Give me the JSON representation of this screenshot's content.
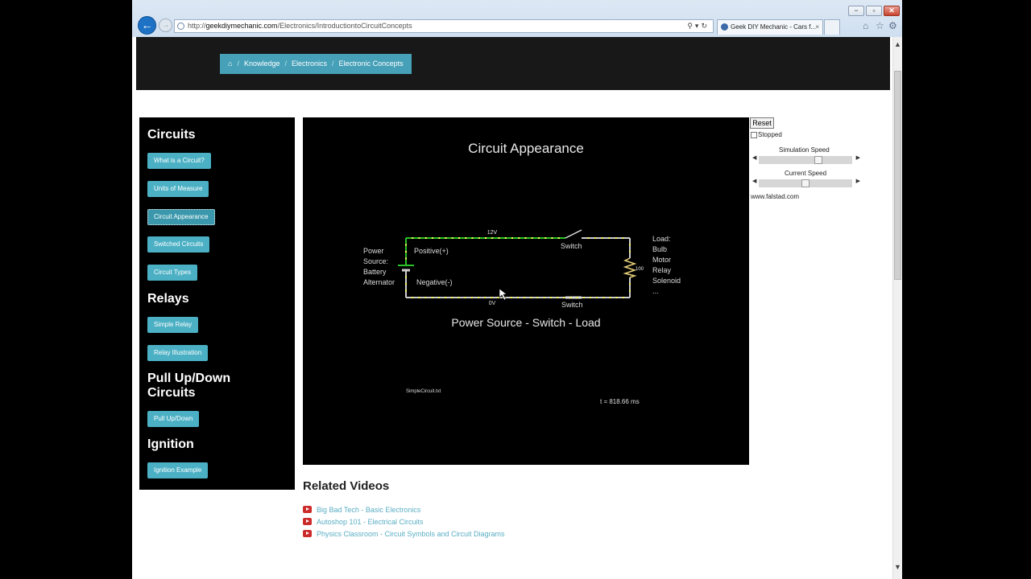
{
  "browser": {
    "url_prefix": "http://",
    "url_domain": "geekdiymechanic.com",
    "url_path": "/Electronics/IntroductiontoCircuitConcepts",
    "tab_title": "Geek DIY Mechanic - Cars f...",
    "tab_close": "×",
    "window_controls": [
      "−",
      "▫",
      "✕"
    ]
  },
  "breadcrumb": {
    "home_icon": "home-icon",
    "items": [
      "Knowledge",
      "Electronics",
      "Electronic Concepts"
    ]
  },
  "sidebar": {
    "circuits": {
      "heading": "Circuits",
      "items": [
        "What is a Circuit?",
        "Units of Measure",
        "Circuit Appearance",
        "Switched Circuits",
        "Circuit Types"
      ]
    },
    "relays": {
      "heading": "Relays",
      "items": [
        "Simple Relay",
        "Relay Illustration"
      ]
    },
    "pullupdown": {
      "heading_line1": "Pull Up/Down",
      "heading_line2": "Circuits",
      "items": [
        "Pull Up/Down"
      ]
    },
    "ignition": {
      "heading": "Ignition",
      "items": [
        "Ignition Example"
      ]
    }
  },
  "simulation": {
    "title": "Circuit Appearance",
    "subtitle": "Power Source - Switch - Load",
    "voltage_top": "12V",
    "voltage_bottom": "0V",
    "switch_top": "Switch",
    "switch_bottom": "Switch",
    "positive": "Positive(+)",
    "negative": "Negative(-)",
    "power_source_lines": [
      "Power",
      "Source:",
      "Battery",
      "Alternator"
    ],
    "load_lines": [
      "Load:",
      "Bulb",
      "Motor",
      "Relay",
      "Solenoid",
      "..."
    ],
    "resistor_value": "100",
    "filename": "SimpleCircuit.txt",
    "time": "t = 818.66 ms",
    "colors": {
      "positive_wire": "#29c229",
      "ground_wire": "#cfcfcf",
      "current_dot": "#ffff55",
      "background": "#000000"
    }
  },
  "controls": {
    "reset": "Reset",
    "stopped": "Stopped",
    "sim_speed_label": "Simulation Speed",
    "sim_speed_level": 0.65,
    "current_speed_label": "Current Speed",
    "current_speed_level": 0.5,
    "credit": "www.falstad.com"
  },
  "related": {
    "title": "Related Videos",
    "items": [
      "Big Bad Tech - Basic Electronics",
      "Autoshop 101 - Electrical Circuits",
      "Physics Classroom - Circuit Symbols and Circuit Diagrams"
    ]
  }
}
